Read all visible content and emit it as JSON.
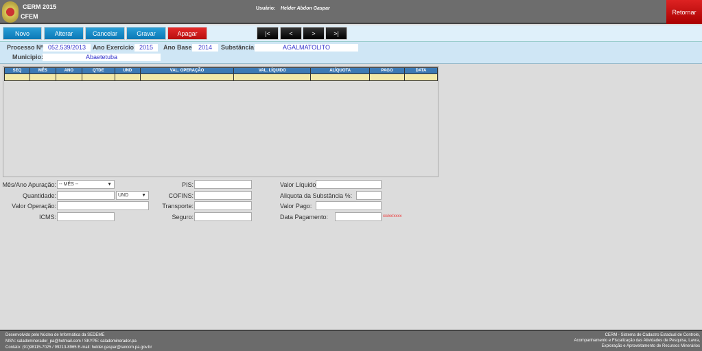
{
  "header": {
    "title": "CERM 2015",
    "subtitle": "CFEM",
    "user_label": "Usuário:",
    "user_name": "Helder Abdon Gaspar",
    "retornar": "Retornar"
  },
  "toolbar": {
    "novo": "Novo",
    "alterar": "Alterar",
    "cancelar": "Cancelar",
    "gravar": "Gravar",
    "apagar": "Apagar",
    "first": "|<",
    "prev": "<",
    "next": ">",
    "last": ">|"
  },
  "info": {
    "processo_label": "Processo Nº:",
    "processo": "052.539/2013",
    "ano_exercicio_label": "Ano Exercicio:",
    "ano_exercicio": "2015",
    "ano_base_label": "Ano Base:",
    "ano_base": "2014",
    "substancia_label": "Substância:",
    "substancia": "AGALMATOLITO",
    "municipio_label": "Municipio:",
    "municipio": "Abaetetuba"
  },
  "grid": {
    "columns": [
      "SEQ",
      "MÊS",
      "ANO",
      "QTDE",
      "UND",
      "VAL. OPERAÇÃO",
      "VAL. LÍQUIDO",
      "ALÍQUOTA",
      "PAGO",
      "DATA"
    ]
  },
  "form": {
    "mes_ano_label": "Mês/Ano Apuração:",
    "mes_select": "-- MÊS --",
    "quantidade_label": "Quantidade:",
    "und_select": "UND",
    "valor_operacao_label": "Valor Operação:",
    "icms_label": "ICMS:",
    "pis_label": "PIS:",
    "cofins_label": "COFINS:",
    "transporte_label": "Transporte:",
    "seguro_label": "Seguro:",
    "valor_liquido_label": "Valor Líquido:",
    "aliquota_label": "Aliquota da Substância %:",
    "valor_pago_label": "Valor Pago:",
    "data_pagamento_label": "Data Pagamento:",
    "date_hint": "xx/xx/xxxx"
  },
  "footer": {
    "left": [
      "Desenvolvido pelo Núcleo de Informática da SEDEME",
      "MSN: saladominerador_pa@hotmail.com / SKYPE: saladominerador.pa",
      "Contato: (91)98115-7025 / 99213-8965 E-mail: helder.gaspar@seicom.pa.gov.br"
    ],
    "right": [
      "CERM - Sistema de Cadastro Estadual de Controle,",
      "Acompanhamento e Fiscalização das Atividades de Pesquisa, Lavra,",
      "Exploração e Aproveitamento de Recursos Minerários"
    ]
  },
  "colors": {
    "header": "#6d6d6d",
    "primary_button": "#0b78b6",
    "danger_button": "#b80e0e",
    "grid_header": "#3d7ab5",
    "grid_row": "#f3e9a8"
  }
}
